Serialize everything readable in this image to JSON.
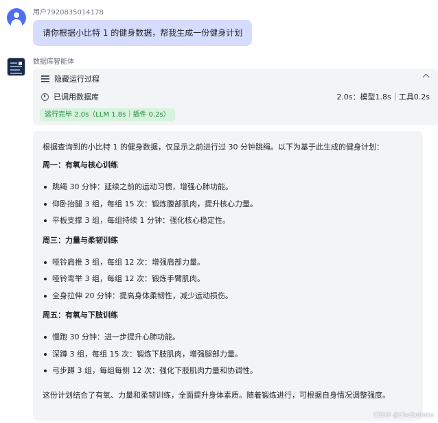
{
  "user": {
    "name": "用户7920835014178",
    "message": "请你根据小比特 1 的健身数据，帮我生成一份健身计划"
  },
  "bot": {
    "name": "数据库智能体",
    "process": {
      "toggle_label": "隐藏运行过程",
      "tool_label": "已调用数据库",
      "tool_stats": "2.0s：模型1.8s｜工具0.2s",
      "status": "运行完毕 2.0s（LLM 1.8s｜插件 0.2s）"
    },
    "answer": {
      "intro": "根据查询到的小比特 1 的健身数据，仅显示之前进行过 30 分钟跳绳。以下为基于此生成的健身计划：",
      "sections": [
        {
          "title": "周一：有氧与核心训练",
          "items": [
            "跳绳 30 分钟：延续之前的运动习惯，增强心肺功能。",
            "仰卧抬腿 3 组，每组 15 次：锻炼腹部肌肉，提升核心力量。",
            "平板支撑 3 组，每组持续 1 分钟：强化核心稳定性。"
          ]
        },
        {
          "title": "周三：力量与柔韧训练",
          "items": [
            "哑铃肩推 3 组，每组 12 次：增强肩部力量。",
            "哑铃弯举 3 组，每组 12 次：锻炼手臂肌肉。",
            "全身拉伸 20 分钟：提高身体柔韧性，减少运动损伤。"
          ]
        },
        {
          "title": "周五：有氧与下肢训练",
          "items": [
            "慢跑 30 分钟：进一步提升心肺功能。",
            "深蹲 3 组，每组 15 次：锻炼下肢肌肉，增强腿部力量。",
            "弓步蹲 3 组，每组每侧 12 次：强化下肢肌肉力量和协调性。"
          ]
        }
      ],
      "outro": "这份计划结合了有氧、力量和柔韧训练，全面提升身体素质。随着锻炼进行，可根据自身情况调整强度。"
    }
  },
  "watermark": "CSDN @ChoSeitaku",
  "icons": {
    "user_avatar": "user-icon",
    "bot_avatar": "bot-avatar",
    "toggle": "list-icon",
    "collapse": "chevron-up-icon",
    "tool": "database-icon"
  },
  "colors": {
    "user_bubble": "#d6dcfd",
    "panel": "#f3f4f6",
    "status_bg": "#d7f2dd",
    "status_text": "#1f8a3b",
    "avatar": "#4e6ef2"
  }
}
